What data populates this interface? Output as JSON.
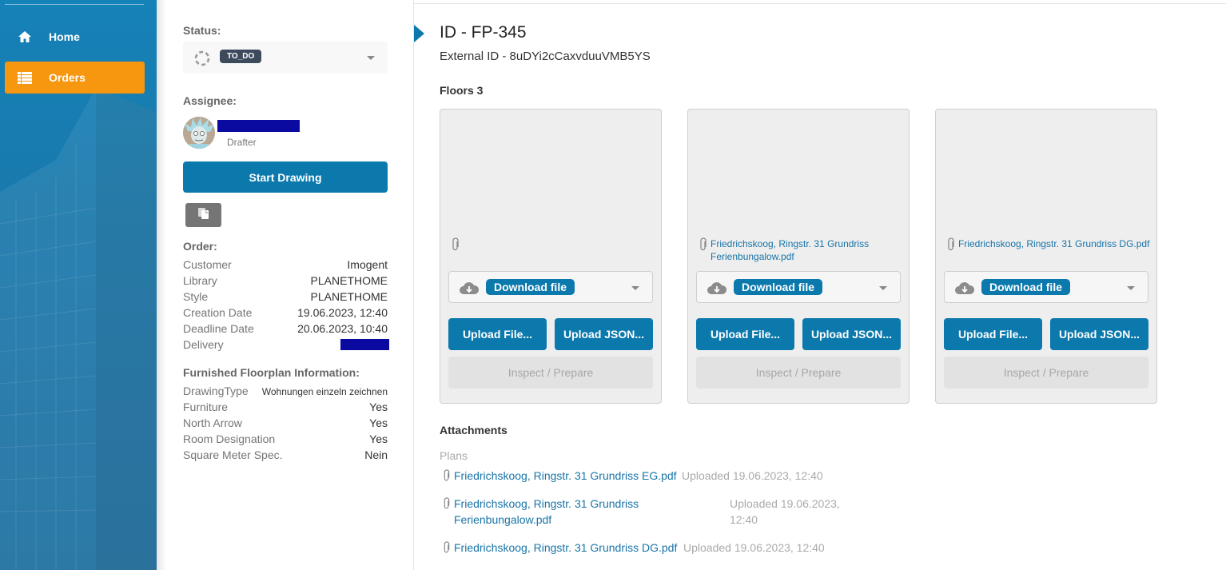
{
  "sidebar": {
    "items": [
      {
        "label": "Home",
        "icon": "home-icon",
        "active": false
      },
      {
        "label": "Orders",
        "icon": "list-icon",
        "active": true
      }
    ],
    "accent": "#f7960f",
    "background": "#1a78ab"
  },
  "left": {
    "status_label": "Status:",
    "status_value": "TO_DO",
    "assignee_label": "Assignee:",
    "assignee_role": "Drafter",
    "start_button": "Start Drawing",
    "order_label": "Order:",
    "order": [
      {
        "key": "Customer",
        "value": "Imogent"
      },
      {
        "key": "Library",
        "value": "PLANETHOME"
      },
      {
        "key": "Style",
        "value": "PLANETHOME"
      },
      {
        "key": "Creation Date",
        "value": "19.06.2023, 12:40"
      },
      {
        "key": "Deadline Date",
        "value": "20.06.2023, 10:40"
      },
      {
        "key": "Delivery",
        "value": ""
      }
    ],
    "furnished_label": "Furnished Floorplan Information:",
    "furnished": [
      {
        "key": "DrawingType",
        "value": "Wohnungen einzeln zeichnen"
      },
      {
        "key": "Furniture",
        "value": "Yes"
      },
      {
        "key": "North Arrow",
        "value": "Yes"
      },
      {
        "key": "Room Designation",
        "value": "Yes"
      },
      {
        "key": "Square Meter Spec.",
        "value": "Nein"
      }
    ]
  },
  "main": {
    "title": "ID - FP-345",
    "external_id": "External ID - 8uDYi2cCaxvduuVMB5YS",
    "floors_label": "Floors 3",
    "floors": [
      {
        "file": "",
        "download": "Download file",
        "upload_file": "Upload File...",
        "upload_json": "Upload JSON...",
        "inspect": "Inspect / Prepare"
      },
      {
        "file": "Friedrichskoog, Ringstr. 31 Grundriss Ferienbungalow.pdf",
        "download": "Download file",
        "upload_file": "Upload File...",
        "upload_json": "Upload JSON...",
        "inspect": "Inspect / Prepare"
      },
      {
        "file": "Friedrichskoog, Ringstr. 31 Grundriss DG.pdf",
        "download": "Download file",
        "upload_file": "Upload File...",
        "upload_json": "Upload JSON...",
        "inspect": "Inspect / Prepare"
      }
    ],
    "attachments_label": "Attachments",
    "plans_label": "Plans",
    "attachments": [
      {
        "name": "Friedrichskoog, Ringstr. 31 Grundriss EG.pdf",
        "uploaded": "Uploaded 19.06.2023, 12:40"
      },
      {
        "name": "Friedrichskoog, Ringstr. 31 Grundriss Ferienbungalow.pdf",
        "uploaded": "Uploaded 19.06.2023, 12:40"
      },
      {
        "name": "Friedrichskoog, Ringstr. 31 Grundriss DG.pdf",
        "uploaded": "Uploaded 19.06.2023, 12:40"
      }
    ],
    "accent": "#0c79ad"
  }
}
